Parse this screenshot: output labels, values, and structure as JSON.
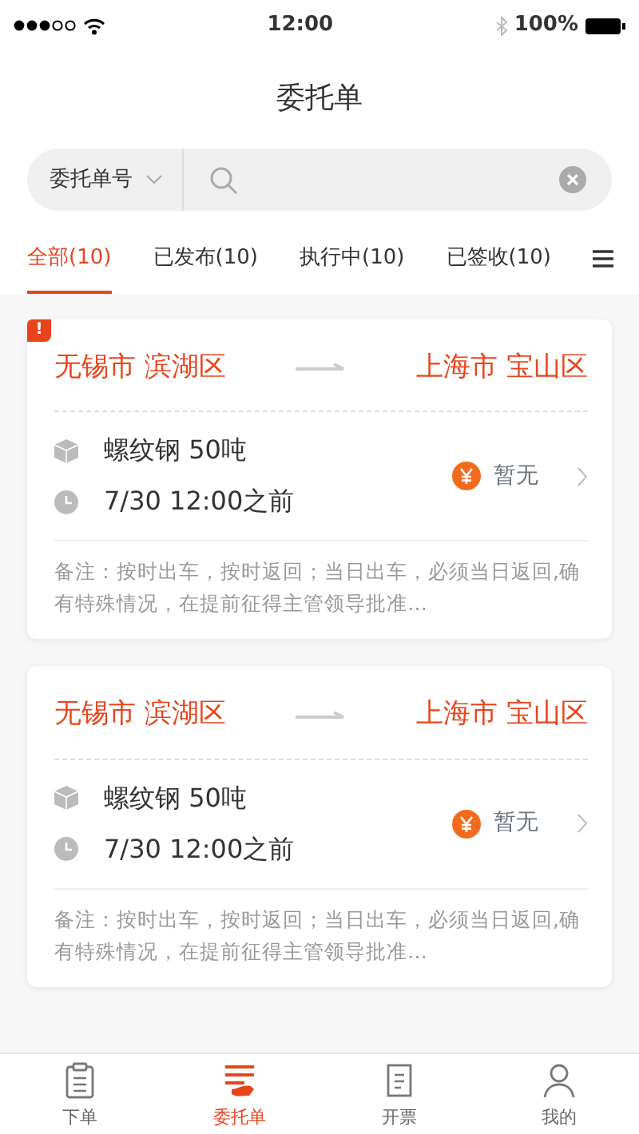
{
  "status_bar": {
    "time": "12:00",
    "battery": "100%"
  },
  "title": "委托单",
  "search": {
    "filter": "委托单号"
  },
  "tabs": [
    {
      "label": "全部(10)",
      "selected": true
    },
    {
      "label": "已发布(10)",
      "selected": false
    },
    {
      "label": "执行中(10)",
      "selected": false
    },
    {
      "label": "已签收(10)",
      "selected": false
    }
  ],
  "orders": [
    {
      "urgent": true,
      "urgent_mark": "!",
      "origin": "无锡市 滨湖区",
      "destination": "上海市 宝山区",
      "goods": "螺纹钢  50吨",
      "deadline": "7/30  12:00之前",
      "price": "暂无",
      "remark": "备注：按时出车，按时返回；当日出车，必须当日返回,确有特殊情况，在提前征得主管领导批准…"
    },
    {
      "urgent": false,
      "origin": "无锡市 滨湖区",
      "destination": "上海市 宝山区",
      "goods": "螺纹钢  50吨",
      "deadline": "7/30  12:00之前",
      "price": "暂无",
      "remark": "备注：按时出车，按时返回；当日出车，必须当日返回,确有特殊情况，在提前征得主管领导批准…"
    }
  ],
  "tab_bar": [
    {
      "label": "下单",
      "kind": "order",
      "selected": false
    },
    {
      "label": "委托单",
      "kind": "list",
      "selected": true
    },
    {
      "label": "开票",
      "kind": "invoice",
      "selected": false
    },
    {
      "label": "我的",
      "kind": "me",
      "selected": false
    }
  ]
}
